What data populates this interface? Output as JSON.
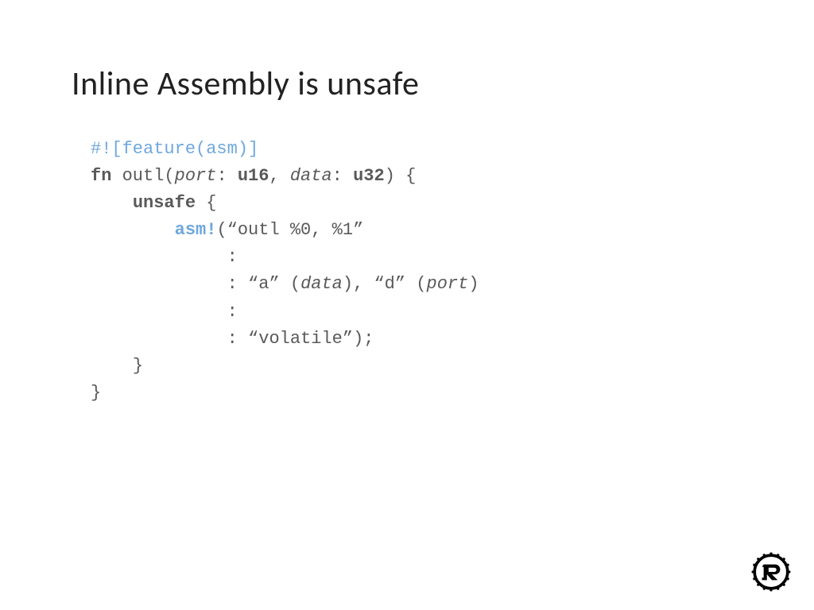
{
  "title": "Inline Assembly is unsafe",
  "code": {
    "l1": {
      "attr": "#![feature(asm)]"
    },
    "l2": {
      "kw_fn": "fn",
      "name": " outl(",
      "p1": "port",
      "sep1": ": ",
      "t1": "u16",
      "sep2": ", ",
      "p2": "data",
      "sep3": ": ",
      "t2": "u32",
      "tail": ") {"
    },
    "l3": {
      "indent": "    ",
      "kw_unsafe": "unsafe",
      "tail": " {"
    },
    "l4": {
      "indent": "        ",
      "macro": "asm!",
      "tail": "(“outl %0, %1”"
    },
    "l5": {
      "indent": "             ",
      "text": ":"
    },
    "l6": {
      "indent": "             ",
      "text1": ": “a” (",
      "v1": "data",
      "text2": "), “d” (",
      "v2": "port",
      "text3": ")"
    },
    "l7": {
      "indent": "             ",
      "text": ":"
    },
    "l8": {
      "indent": "             ",
      "text": ": “volatile”);"
    },
    "l9": {
      "indent": "    ",
      "text": "}"
    },
    "l10": {
      "text": "}"
    }
  },
  "logo_name": "rust-logo"
}
